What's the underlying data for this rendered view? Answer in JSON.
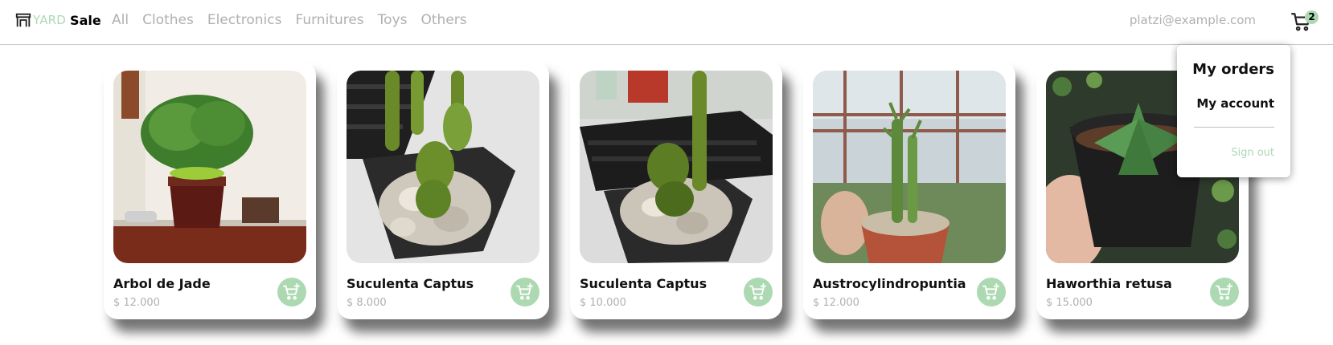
{
  "brand": {
    "logo_icon": "store-icon",
    "name_accent": "YARD",
    "name_main": "Sale",
    "accent_color": "#acd9b2"
  },
  "nav": {
    "categories": [
      {
        "label": "All"
      },
      {
        "label": "Clothes"
      },
      {
        "label": "Electronics"
      },
      {
        "label": "Furnitures"
      },
      {
        "label": "Toys"
      },
      {
        "label": "Others"
      }
    ],
    "email": "platzi@example.com",
    "cart": {
      "icon": "shopping-cart-icon",
      "count": "2"
    }
  },
  "account_menu": {
    "my_orders": "My orders",
    "my_account": "My account",
    "sign_out": "Sign out"
  },
  "products": [
    {
      "name": "Arbol de Jade",
      "price": "$ 12.000",
      "image": "jade-tree-bonsai"
    },
    {
      "name": "Suculenta Captus",
      "price": "$ 8.000",
      "image": "cactus-pot-keyboard"
    },
    {
      "name": "Suculenta Captus",
      "price": "$ 10.000",
      "image": "cactus-pot-desk"
    },
    {
      "name": "Austrocylindropuntia",
      "price": "$ 12.000",
      "image": "columnar-cactus-greenhouse"
    },
    {
      "name": "Haworthia retusa",
      "price": "$ 15.000",
      "image": "haworthia-in-hand"
    }
  ]
}
